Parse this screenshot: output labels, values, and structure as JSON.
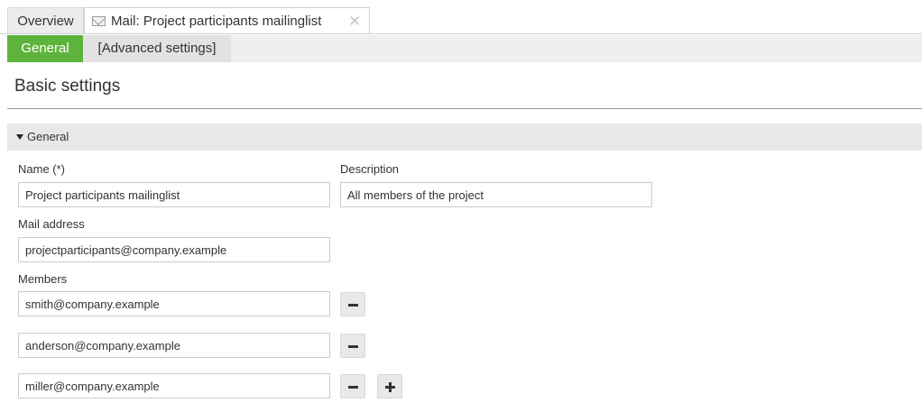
{
  "tabs": {
    "overview": "Overview",
    "mail": "Mail: Project participants mailinglist",
    "close": "✕"
  },
  "subtabs": {
    "general": "General",
    "advanced": "[Advanced settings]"
  },
  "page_title": "Basic settings",
  "section": {
    "title": "General"
  },
  "form": {
    "name_label": "Name (*)",
    "name_value": "Project participants mailinglist",
    "description_label": "Description",
    "description_value": "All members of the project",
    "mail_label": "Mail address",
    "mail_value": "projectparticipants@company.example",
    "members_label": "Members",
    "members": [
      "smith@company.example",
      "anderson@company.example",
      "miller@company.example"
    ]
  },
  "colors": {
    "accent": "#5eb33c"
  }
}
